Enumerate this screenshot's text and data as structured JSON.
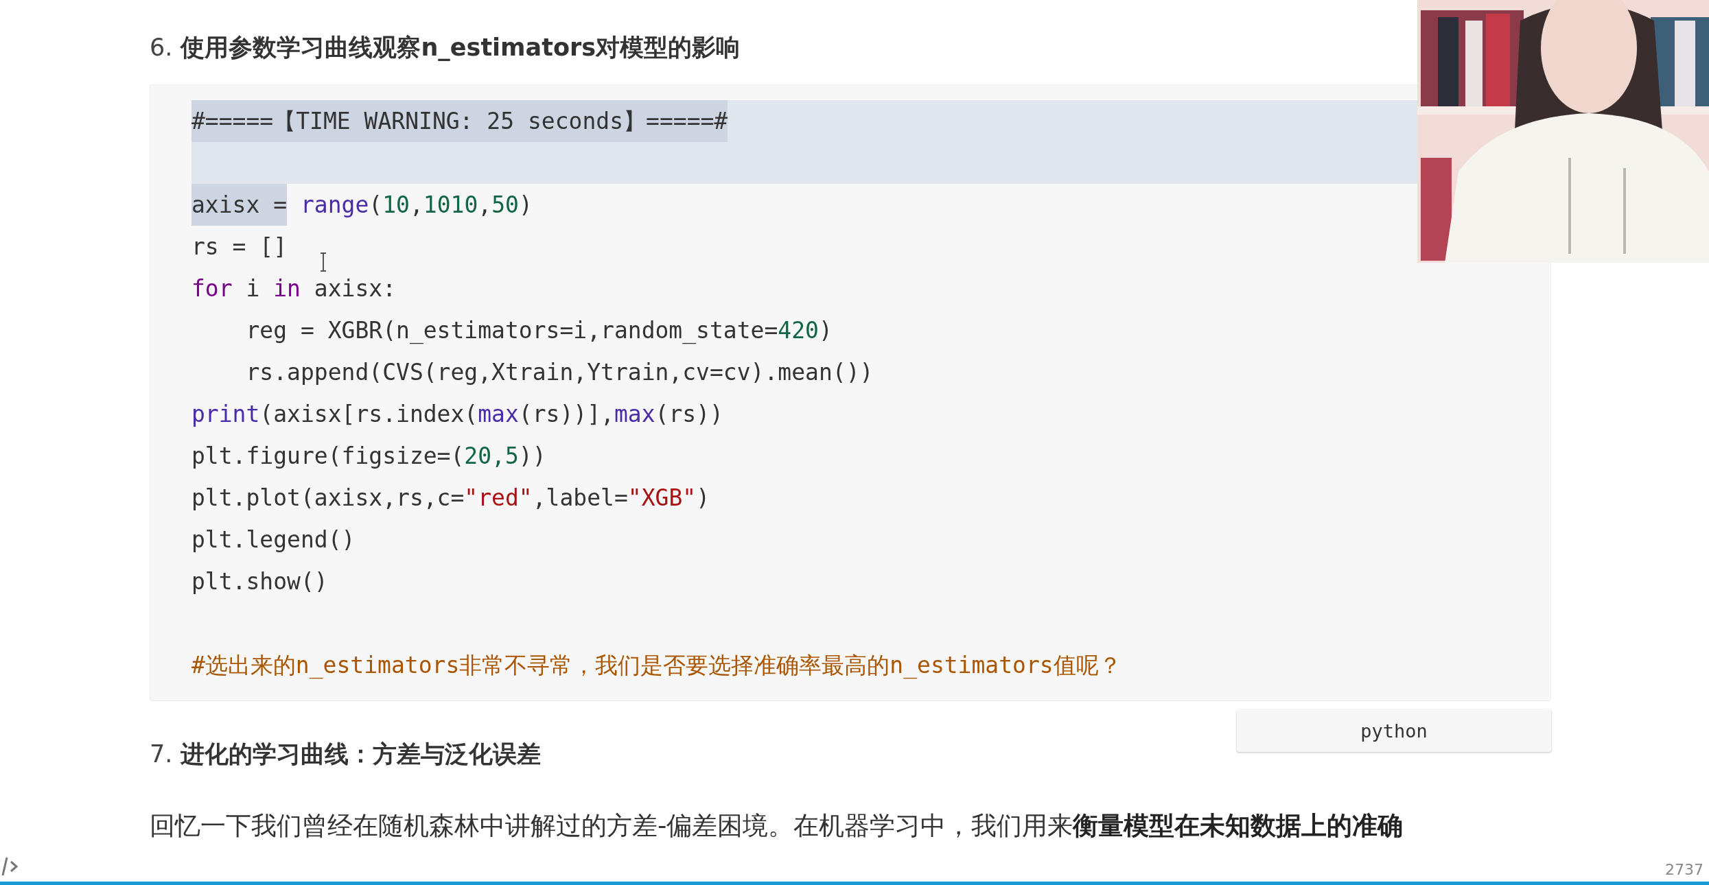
{
  "heading_6": {
    "number": "6.",
    "title": "使用参数学习曲线观察n_estimators对模型的影响"
  },
  "code_block": {
    "language": "python",
    "lines": [
      {
        "selected": true,
        "tokens": [
          {
            "text": "#=====【TIME WARNING: 25 seconds】=====#",
            "kind": "plain",
            "selected": true
          }
        ]
      },
      {
        "selected": true
      },
      {
        "selected": false,
        "tokens": [
          {
            "text": "axisx =",
            "kind": "plain",
            "selected": true
          },
          {
            "text": " range",
            "kind": "builtin",
            "selected": false
          },
          {
            "text": "(",
            "kind": "plain",
            "selected": false
          },
          {
            "text": "10",
            "kind": "number",
            "selected": false
          },
          {
            "text": ",",
            "kind": "plain",
            "selected": false
          },
          {
            "text": "1010",
            "kind": "number",
            "selected": false
          },
          {
            "text": ",",
            "kind": "plain",
            "selected": false
          },
          {
            "text": "50",
            "kind": "number",
            "selected": false
          },
          {
            "text": ")",
            "kind": "plain",
            "selected": false
          }
        ]
      },
      {
        "selected": false,
        "tokens": [
          {
            "text": "rs = []",
            "kind": "plain",
            "selected": false
          }
        ]
      },
      {
        "selected": false,
        "tokens": [
          {
            "text": "for",
            "kind": "keyword",
            "selected": false
          },
          {
            "text": " i ",
            "kind": "plain",
            "selected": false
          },
          {
            "text": "in",
            "kind": "keyword",
            "selected": false
          },
          {
            "text": " axisx:",
            "kind": "plain",
            "selected": false
          }
        ]
      },
      {
        "selected": false,
        "tokens": [
          {
            "text": "    reg = XGBR(n_estimators=i,random_state=",
            "kind": "plain",
            "selected": false
          },
          {
            "text": "420",
            "kind": "number",
            "selected": false
          },
          {
            "text": ")",
            "kind": "plain",
            "selected": false
          }
        ]
      },
      {
        "selected": false,
        "tokens": [
          {
            "text": "    rs.append(CVS(reg,Xtrain,Ytrain,cv=cv).mean())",
            "kind": "plain",
            "selected": false
          }
        ]
      },
      {
        "selected": false,
        "tokens": [
          {
            "text": "print",
            "kind": "builtin",
            "selected": false
          },
          {
            "text": "(axisx[rs.index(",
            "kind": "plain",
            "selected": false
          },
          {
            "text": "max",
            "kind": "builtin",
            "selected": false
          },
          {
            "text": "(rs))],",
            "kind": "plain",
            "selected": false
          },
          {
            "text": "max",
            "kind": "builtin",
            "selected": false
          },
          {
            "text": "(rs))",
            "kind": "plain",
            "selected": false
          }
        ]
      },
      {
        "selected": false,
        "tokens": [
          {
            "text": "plt.figure(figsize=(",
            "kind": "plain",
            "selected": false
          },
          {
            "text": "20,5",
            "kind": "number",
            "selected": false
          },
          {
            "text": "))",
            "kind": "plain",
            "selected": false
          }
        ]
      },
      {
        "selected": false,
        "tokens": [
          {
            "text": "plt.plot(axisx,rs,c=",
            "kind": "plain",
            "selected": false
          },
          {
            "text": "\"red\"",
            "kind": "string",
            "selected": false
          },
          {
            "text": ",label=",
            "kind": "plain",
            "selected": false
          },
          {
            "text": "\"XGB\"",
            "kind": "string",
            "selected": false
          },
          {
            "text": ")",
            "kind": "plain",
            "selected": false
          }
        ]
      },
      {
        "selected": false,
        "tokens": [
          {
            "text": "plt.legend()",
            "kind": "plain",
            "selected": false
          }
        ]
      },
      {
        "selected": false,
        "tokens": [
          {
            "text": "plt.show()",
            "kind": "plain",
            "selected": false
          }
        ]
      },
      {
        "selected": false
      },
      {
        "selected": false,
        "tokens": [
          {
            "text": "#选出来的n_estimators非常不寻常，我们是否要选择准确率最高的n_estimators值呢？",
            "kind": "comment",
            "selected": false
          }
        ]
      }
    ]
  },
  "heading_7": {
    "number": "7.",
    "title": "进化的学习曲线：方差与泛化误差"
  },
  "paragraph": "回忆一下我们曾经在随机森林中讲解过的方差-偏差困境。在机器学习中，我们用来**衡量模型在未知数据上的准确**",
  "status_bar": {
    "word_count": "2737"
  }
}
